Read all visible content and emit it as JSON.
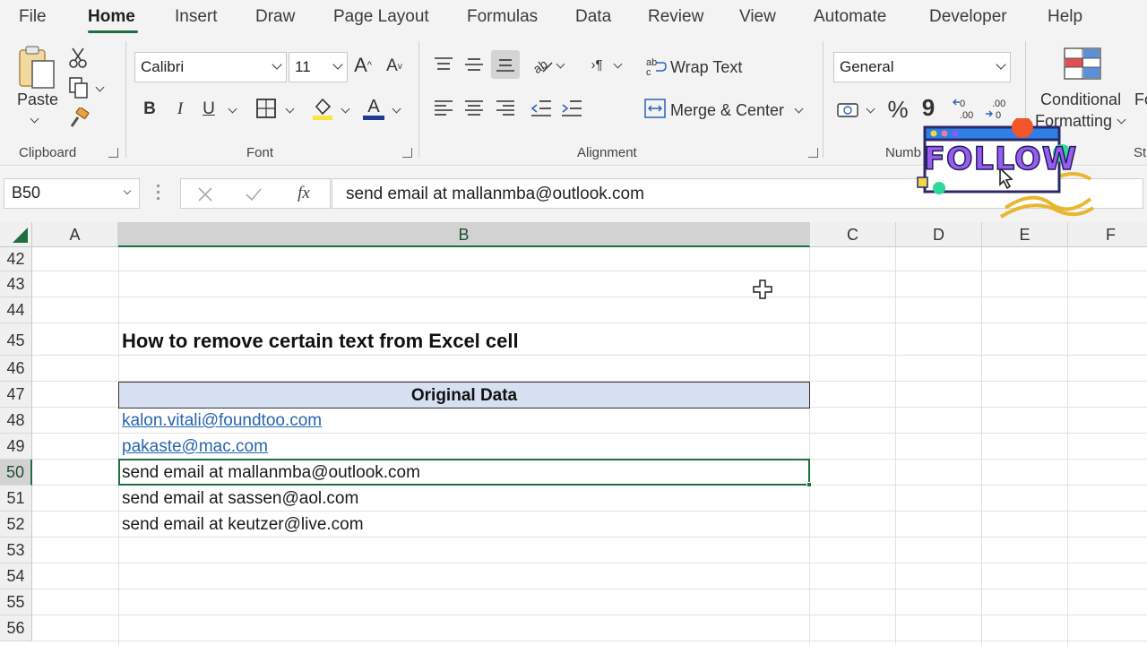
{
  "tabs": [
    "File",
    "Home",
    "Insert",
    "Draw",
    "Page Layout",
    "Formulas",
    "Data",
    "Review",
    "View",
    "Automate",
    "Developer",
    "Help"
  ],
  "active_tab": "Home",
  "ribbon": {
    "clipboard": {
      "paste_label": "Paste",
      "group_label": "Clipboard"
    },
    "font": {
      "font_name": "Calibri",
      "font_size": "11",
      "bold": "B",
      "italic": "I",
      "underline": "U",
      "group_label": "Font"
    },
    "alignment": {
      "wrap_text": "Wrap Text",
      "merge_center": "Merge & Center",
      "group_label": "Alignment"
    },
    "number": {
      "format": "General",
      "percent": "%",
      "comma": "9",
      "group_label": "Numb"
    },
    "styles": {
      "conditional_line1": "Conditional",
      "conditional_line2": "Formatting",
      "format_partial": "Fo",
      "styles_partial": "St"
    }
  },
  "sticker": {
    "text": "FOLLOW"
  },
  "formula_bar": {
    "name_box": "B50",
    "fx_label": "fx",
    "formula": "send email at mallanmba@outlook.com"
  },
  "grid": {
    "columns": [
      "A",
      "B",
      "C",
      "D",
      "E",
      "F"
    ],
    "selected_column": "B",
    "rows": [
      "42",
      "43",
      "44",
      "45",
      "46",
      "47",
      "48",
      "49",
      "50",
      "51",
      "52",
      "53",
      "54",
      "55",
      "56"
    ],
    "selected_row": "50",
    "title": "How to remove certain text from Excel cell",
    "table_header": "Original Data",
    "data": [
      "kalon.vitali@foundtoo.com",
      "pakaste@mac.com",
      "send email at mallanmba@outlook.com",
      "send email at sassen@aol.com",
      "send email at keutzer@live.com"
    ]
  },
  "colors": {
    "accent_green": "#1e6e42",
    "header_fill": "#d6e0f0",
    "link_blue": "#2565b0"
  }
}
